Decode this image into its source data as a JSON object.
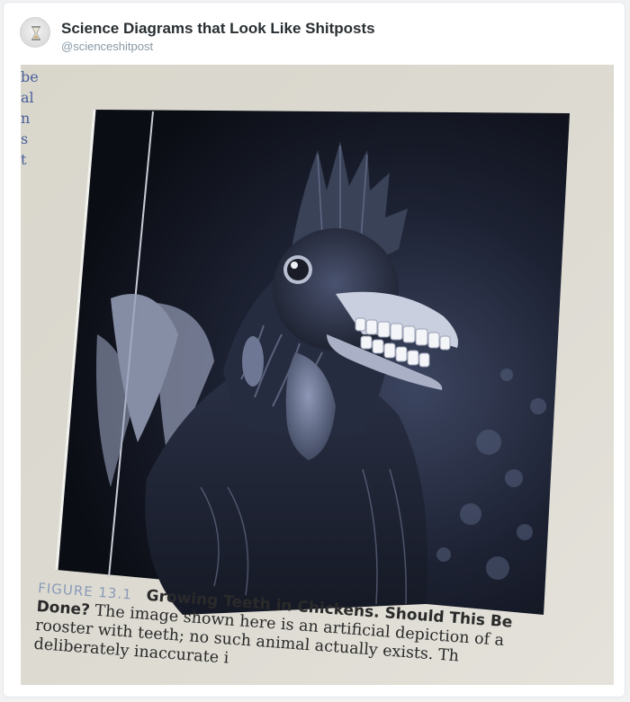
{
  "post": {
    "display_name": "Science Diagrams that Look Like Shitposts",
    "handle": "@scienceshitpost",
    "avatar_icon": "hourglass-avatar-icon"
  },
  "image": {
    "margin_fragments": [
      "be",
      "al",
      "n",
      "s",
      "t"
    ],
    "caption": {
      "figure_label": "FIGURE 13.1",
      "title_part1": "Growing Teeth in Chickens. Should This Be",
      "title_part2": "Done?",
      "line1_rest": "The image shown here is an artificial depiction of a",
      "line2": "rooster with teeth; no such animal actually exists. Th",
      "line3": "deliberately inaccurate i"
    }
  },
  "colors": {
    "card_bg": "#ffffff",
    "name_text": "#292f33",
    "handle_text": "#8899a6",
    "figure_label": "#8a9ab8"
  }
}
